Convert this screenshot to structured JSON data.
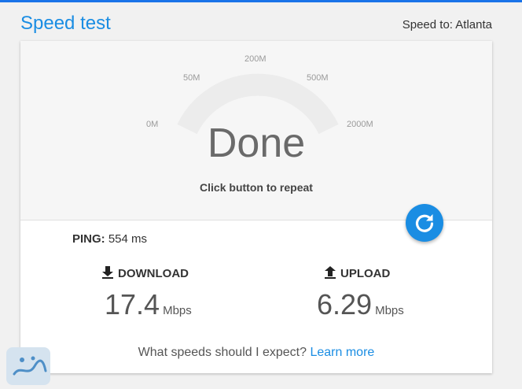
{
  "header": {
    "title": "Speed test",
    "speed_to": "Speed to: Atlanta"
  },
  "gauge": {
    "ticks": [
      "0M",
      "50M",
      "200M",
      "500M",
      "2000M"
    ],
    "status": "Done",
    "hint": "Click button to repeat"
  },
  "repeat_icon": "refresh-icon",
  "ping": {
    "label": "PING:",
    "value": "554 ms"
  },
  "download": {
    "label": "DOWNLOAD",
    "value": "17.4",
    "unit": "Mbps",
    "icon": "download-arrow-icon"
  },
  "upload": {
    "label": "UPLOAD",
    "value": "6.29",
    "unit": "Mbps",
    "icon": "upload-arrow-icon"
  },
  "footer": {
    "question": "What speeds should I expect?",
    "link": "Learn more"
  },
  "colors": {
    "accent": "#1a8de3",
    "top_bar": "#1a73e8"
  }
}
